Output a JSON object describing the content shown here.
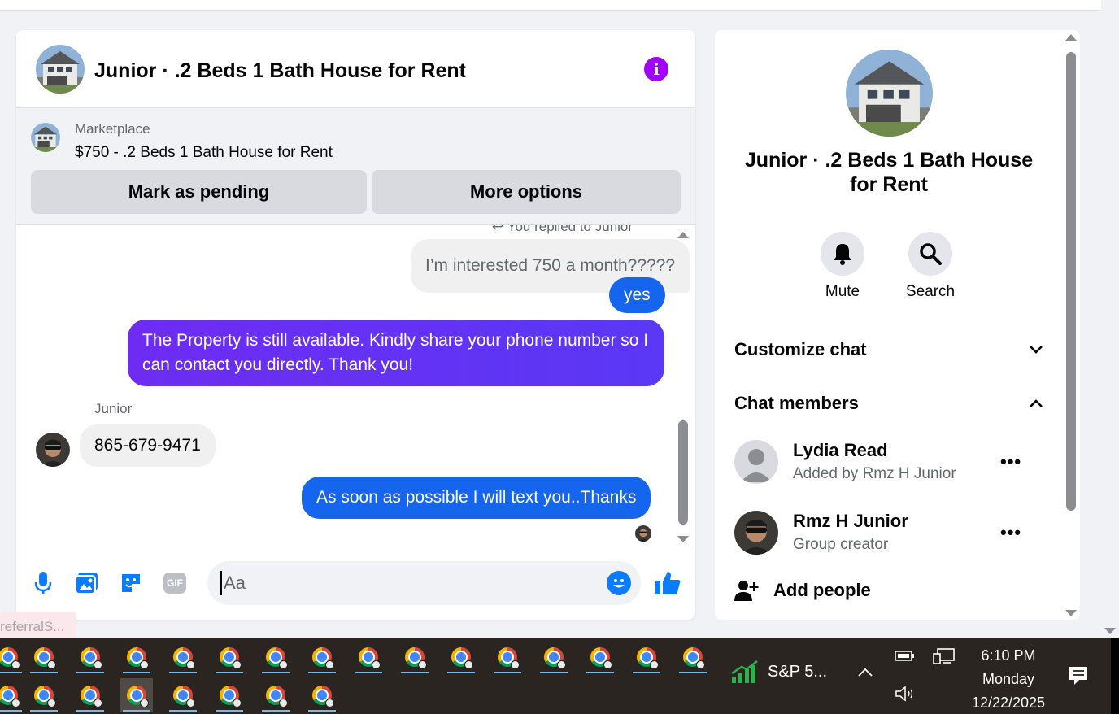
{
  "chat": {
    "title": "Junior · .2 Beds 1 Bath House for Rent",
    "info_icon": "info-icon",
    "marketplace": {
      "label": "Marketplace",
      "listing": "$750 - .2 Beds 1 Bath House for Rent",
      "mark_pending": "Mark as pending",
      "more_options": "More options"
    },
    "messages": {
      "replied_note": "You replied to Junior",
      "quoted": "I’m interested 750 a month?????",
      "yes": "yes",
      "property_msg": "The Property is still available. Kindly share your phone number so I can contact you directly. Thank you!",
      "sender": "Junior",
      "phone": "865-679-9471",
      "reply": "As soon as possible I will text you..Thanks"
    },
    "composer": {
      "placeholder": "Aa",
      "icons": [
        "microphone-icon",
        "photo-icon",
        "sticker-icon",
        "gif-icon",
        "emoji-icon",
        "thumbs-up-icon"
      ],
      "gif_text": "GIF"
    }
  },
  "tab_fragment": "referralS...",
  "panel": {
    "title": "Junior · .2 Beds 1 Bath House for Rent",
    "mute": "Mute",
    "search": "Search",
    "customize": "Customize chat",
    "members_header": "Chat members",
    "members": [
      {
        "name": "Lydia Read",
        "sub": "Added by Rmz H Junior",
        "more": "•••"
      },
      {
        "name": "Rmz H Junior",
        "sub": "Group creator",
        "more": "•••"
      }
    ],
    "add_people": "Add people"
  },
  "taskbar": {
    "widget": "S&P 5...",
    "time": "6:10 PM",
    "day": "Monday",
    "date": "12/22/2025",
    "colors": {
      "bg": "#2a2520",
      "accent": "#76b9ed"
    }
  },
  "colors": {
    "messenger_blue": "#1565ef",
    "purple": "#6e2cf2",
    "info_purple": "#a100ff"
  }
}
